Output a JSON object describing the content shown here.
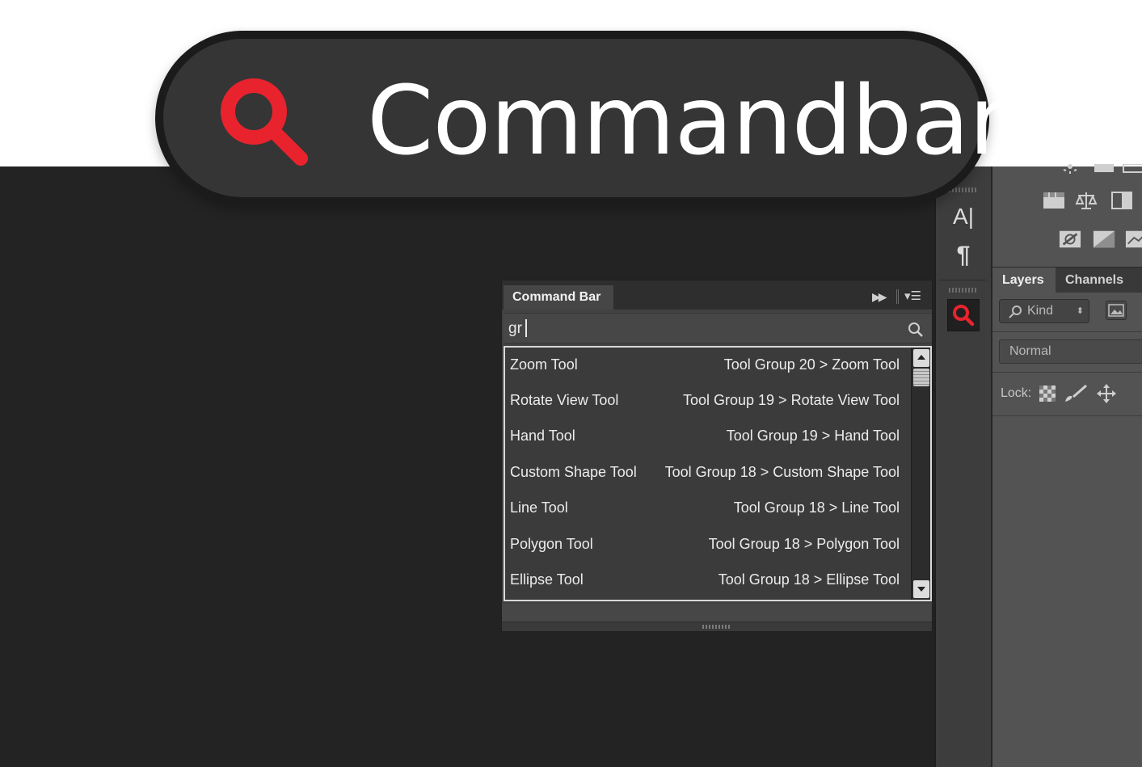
{
  "hero": {
    "title": "Commandbar",
    "icon": "search-icon",
    "icon_color": "#e8232e"
  },
  "tool_strip": {
    "items": [
      {
        "icon": "character-panel-icon",
        "label": "A|"
      },
      {
        "icon": "paragraph-panel-icon",
        "label": "¶"
      },
      {
        "icon": "commandbar-search-icon",
        "active": true,
        "color": "#e8232e"
      }
    ]
  },
  "right_panel": {
    "tabs": [
      {
        "label": "Layers",
        "active": true
      },
      {
        "label": "Channels",
        "active": false
      }
    ],
    "filter_kind": "Kind",
    "blend_mode": "Normal",
    "lock_label": "Lock:"
  },
  "command_bar": {
    "tab_title": "Command Bar",
    "search_value": "gr",
    "results": [
      {
        "name": "Zoom Tool",
        "path": "Tool Group 20 > Zoom Tool"
      },
      {
        "name": "Rotate View Tool",
        "path": "Tool Group 19 > Rotate View Tool"
      },
      {
        "name": "Hand Tool",
        "path": "Tool Group 19 > Hand Tool"
      },
      {
        "name": "Custom Shape Tool",
        "path": "Tool Group 18 > Custom Shape Tool"
      },
      {
        "name": "Line Tool",
        "path": "Tool Group 18 > Line Tool"
      },
      {
        "name": "Polygon Tool",
        "path": "Tool Group 18 > Polygon Tool"
      },
      {
        "name": "Ellipse Tool",
        "path": "Tool Group 18 > Ellipse Tool"
      }
    ]
  },
  "colors": {
    "accent": "#e8232e",
    "canvas": "#232323",
    "panel": "#535353"
  }
}
